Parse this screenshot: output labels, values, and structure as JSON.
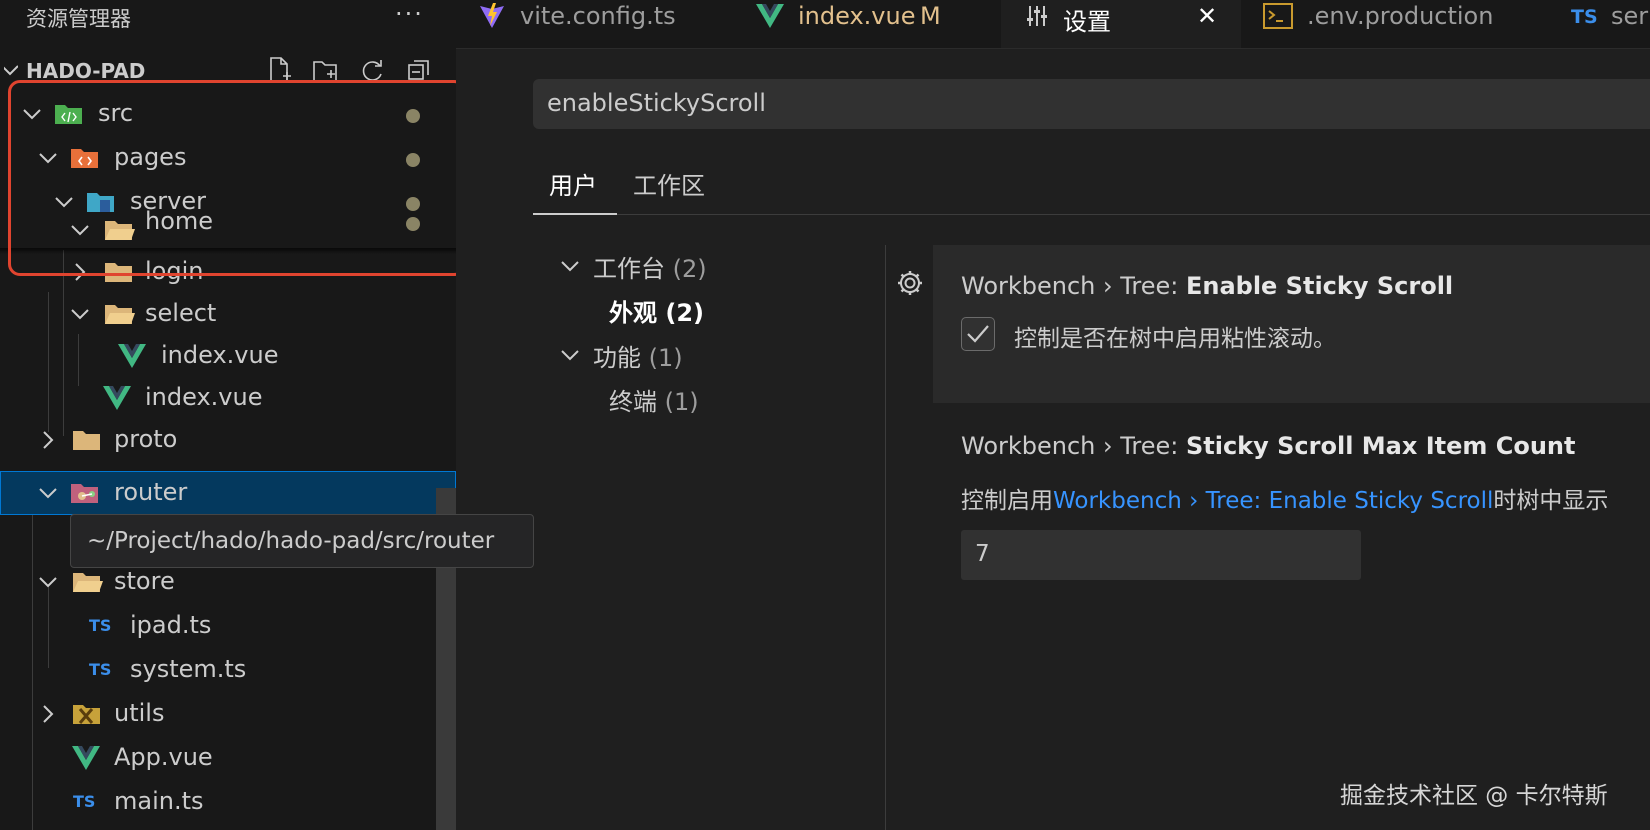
{
  "sidebar": {
    "title": "资源管理器",
    "more": "···",
    "project": "HADO-PAD",
    "tree": {
      "src": "src",
      "pages": "pages",
      "server": "server",
      "home": "home",
      "login": "login",
      "select": "select",
      "select_index": "index.vue",
      "server_index": "index.vue",
      "proto": "proto",
      "router": "router",
      "store": "store",
      "ipad": "ipad.ts",
      "system": "system.ts",
      "utils": "utils",
      "app": "App.vue",
      "main": "main.ts"
    },
    "tooltip": "~/Project/hado/hado-pad/src/router"
  },
  "tabs": {
    "vite": "vite.config.ts",
    "index": "index.vue",
    "index_badge": "M",
    "settings": "设置",
    "settings_close": "✕",
    "env": ".env.production",
    "ser": "ser"
  },
  "ts_badge": "TS",
  "settings": {
    "search": "enableStickyScroll",
    "scope_user": "用户",
    "scope_workspace": "工作区",
    "toc": {
      "workbench": "工作台",
      "workbench_count": "(2)",
      "appearance": "外观",
      "appearance_count": "(2)",
      "features": "功能",
      "features_count": "(1)",
      "terminal": "终端",
      "terminal_count": "(1)"
    },
    "item1": {
      "prefix": "Workbench › Tree: ",
      "name": "Enable Sticky Scroll",
      "description": "控制是否在树中启用粘性滚动。",
      "checked": true
    },
    "item2": {
      "prefix": "Workbench › Tree: ",
      "name": "Sticky Scroll Max Item Count",
      "desc_before": "控制启用",
      "desc_link": "Workbench › Tree: Enable Sticky Scroll",
      "desc_after": "时树中显示",
      "value": "7"
    }
  },
  "watermark": "掘金技术社区 @ 卡尔特斯",
  "colors": {
    "accent": "#0078d4",
    "link": "#3794ff",
    "highlight_box": "#e0442f",
    "modified": "#e2c08d",
    "vue_green": "#41b883"
  }
}
